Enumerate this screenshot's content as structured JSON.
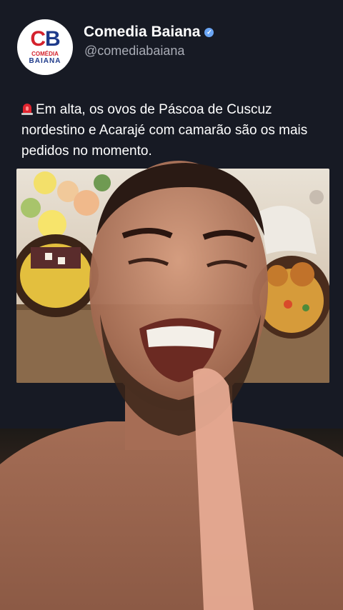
{
  "account": {
    "name": "Comedia Baiana",
    "handle": "@comediabaiana",
    "verified": true,
    "avatar": {
      "initial_c": "C",
      "initial_b": "B",
      "line1": "COMÉDIA",
      "line2": "BAIANA"
    }
  },
  "post": {
    "icon": "siren-icon",
    "text": "Em alta, os ovos de Páscoa de Cuscuz nordestino e Acarajé com camarão são os mais pedidos no momento."
  },
  "colors": {
    "background": "#171a24",
    "text": "#ffffff",
    "handle": "#a9acb6",
    "verified": "#6ba6f5",
    "brand_red": "#d4222d",
    "brand_blue": "#1e3a8a"
  }
}
